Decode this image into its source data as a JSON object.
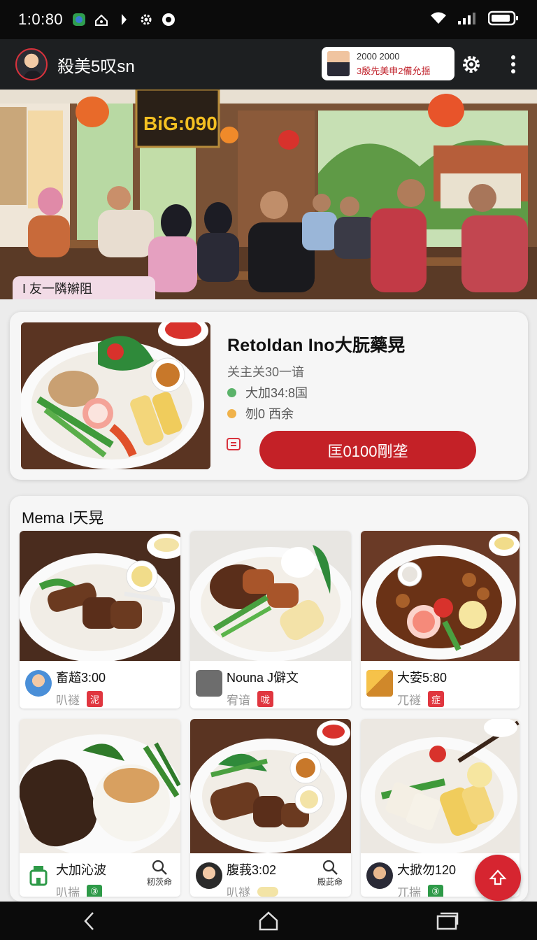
{
  "status_bar": {
    "time": "1:0:80"
  },
  "header": {
    "title": "殺美5叹ѕn",
    "promo": {
      "line1": "2000 2000",
      "line2": "3殷先美申2備允揺"
    }
  },
  "hero": {
    "sign_text": "BiG:090",
    "tag": "I 友一隣辮阻"
  },
  "featured": {
    "title": "Retoldan Ino大朊藥晃",
    "subtitle": "关主关30一谙",
    "rows": [
      {
        "text": "大加34:8国",
        "color": "#5bb36a"
      },
      {
        "text": "刎0 西余",
        "color": "#f0b24a"
      }
    ],
    "button_label": "匡0100剛垄"
  },
  "menu": {
    "title": "Mema I天晃",
    "items": [
      {
        "name": "畜趦3:00",
        "meta": "叭禭",
        "tag": "泥",
        "tag_style": "red"
      },
      {
        "name": "Nouna J僻文",
        "meta": "宥谙",
        "tag": "咙",
        "tag_style": "red"
      },
      {
        "name": "大荌5:80",
        "meta": "兀禭",
        "tag": "症",
        "tag_style": "red"
      },
      {
        "name": "大加沁波",
        "meta": "叭揣",
        "tag": "③",
        "tag_style": "green",
        "action": "籾茨命"
      },
      {
        "name": "腹莪3:02",
        "meta": "叭禭",
        "tag": "",
        "tag_style": "pale",
        "action": "殿茈命"
      },
      {
        "name": "大掀勿120",
        "meta": "兀揣",
        "tag": "③",
        "tag_style": "green"
      }
    ]
  },
  "colors": {
    "accent": "#c42127",
    "header_bg": "#1d1f21",
    "card_bg": "#f6f6f6"
  }
}
